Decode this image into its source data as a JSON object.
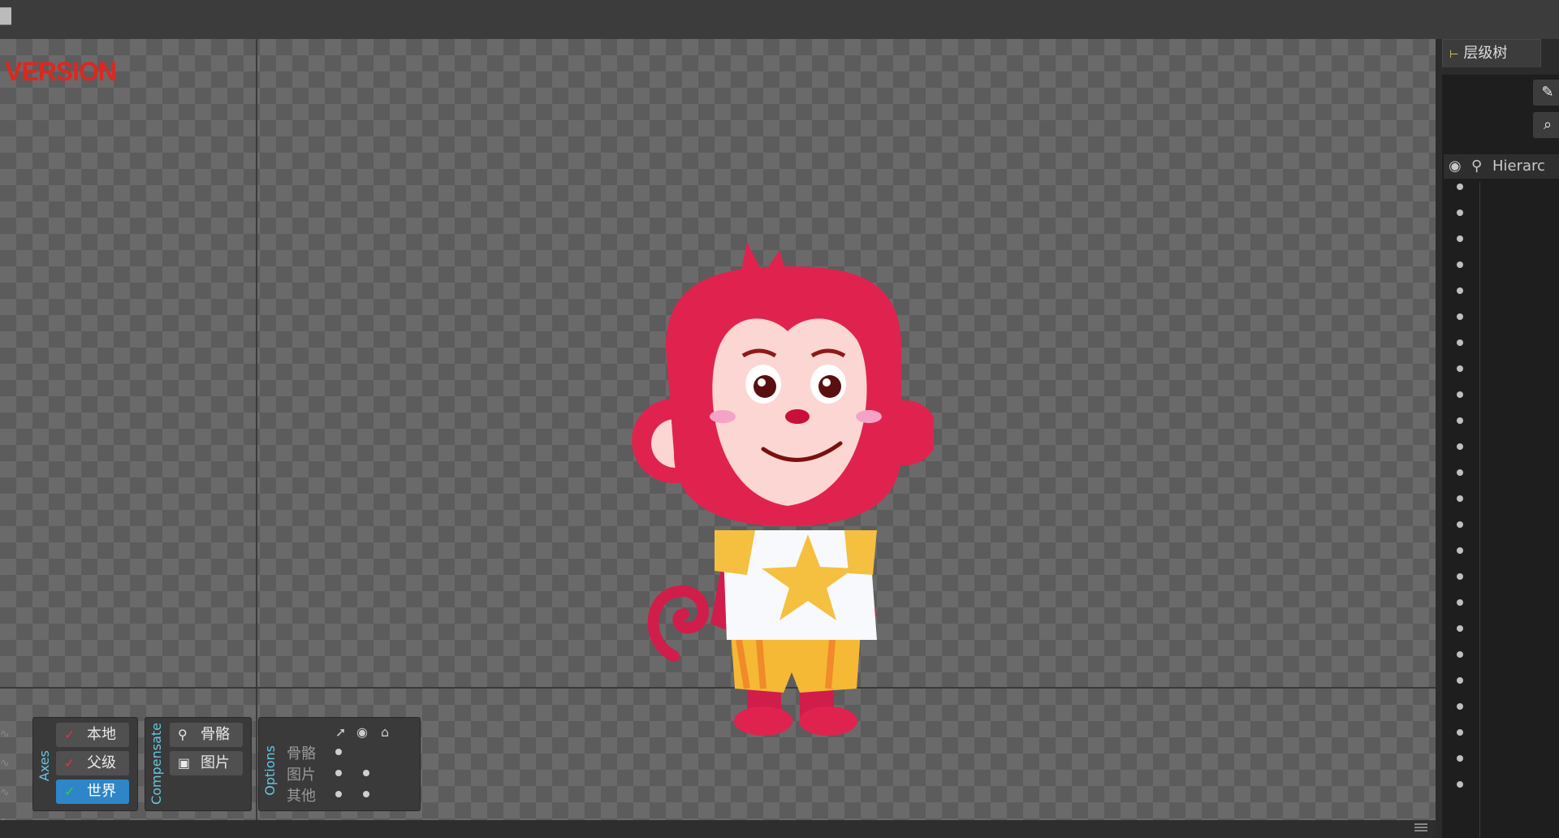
{
  "topbar": {
    "glyph": "█"
  },
  "viewport": {
    "watermark": "VERSION",
    "colors": {
      "checker_light": "#6a6a6a",
      "checker_dark": "#5c5c5c",
      "watermark": "#e0261f"
    }
  },
  "axes_group": {
    "label": "Axes",
    "buttons": [
      {
        "label": "本地",
        "icon": "axes-local-icon",
        "active": false
      },
      {
        "label": "父级",
        "icon": "axes-parent-icon",
        "active": false
      },
      {
        "label": "世界",
        "icon": "axes-world-icon",
        "active": true
      }
    ]
  },
  "compensate_group": {
    "label": "Compensate",
    "buttons": [
      {
        "label": "骨骼",
        "icon": "bone-icon"
      },
      {
        "label": "图片",
        "icon": "image-icon"
      }
    ]
  },
  "options_group": {
    "label": "Options",
    "header_icons": [
      "select-icon",
      "eye-icon",
      "tag-icon"
    ],
    "rows": [
      {
        "label": "骨骼"
      },
      {
        "label": "图片"
      },
      {
        "label": "其他"
      }
    ]
  },
  "right_panel": {
    "tab_label": "层级树",
    "hierarchy_header": "Hierarc",
    "accent": "#2e86c8"
  }
}
